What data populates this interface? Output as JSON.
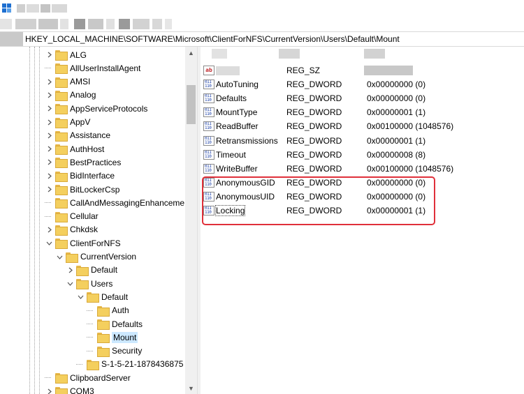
{
  "address": {
    "path": "HKEY_LOCAL_MACHINE\\SOFTWARE\\Microsoft\\ClientForNFS\\CurrentVersion\\Users\\Default\\Mount"
  },
  "tree": {
    "items": [
      {
        "label": "ALG",
        "expand": ">",
        "level": 0
      },
      {
        "label": "AllUserInstallAgent",
        "expand": "",
        "level": 0
      },
      {
        "label": "AMSI",
        "expand": ">",
        "level": 0
      },
      {
        "label": "Analog",
        "expand": ">",
        "level": 0
      },
      {
        "label": "AppServiceProtocols",
        "expand": ">",
        "level": 0
      },
      {
        "label": "AppV",
        "expand": ">",
        "level": 0
      },
      {
        "label": "Assistance",
        "expand": ">",
        "level": 0
      },
      {
        "label": "AuthHost",
        "expand": ">",
        "level": 0
      },
      {
        "label": "BestPractices",
        "expand": ">",
        "level": 0
      },
      {
        "label": "BidInterface",
        "expand": ">",
        "level": 0
      },
      {
        "label": "BitLockerCsp",
        "expand": ">",
        "level": 0
      },
      {
        "label": "CallAndMessagingEnhanceme",
        "expand": "",
        "level": 0
      },
      {
        "label": "Cellular",
        "expand": "",
        "level": 0
      },
      {
        "label": "Chkdsk",
        "expand": ">",
        "level": 0
      },
      {
        "label": "ClientForNFS",
        "expand": "v",
        "level": 0
      },
      {
        "label": "CurrentVersion",
        "expand": "v",
        "level": 1
      },
      {
        "label": "Default",
        "expand": ">",
        "level": 2
      },
      {
        "label": "Users",
        "expand": "v",
        "level": 2
      },
      {
        "label": "Default",
        "expand": "v",
        "level": 3
      },
      {
        "label": "Auth",
        "expand": "",
        "level": 4
      },
      {
        "label": "Defaults",
        "expand": "",
        "level": 4
      },
      {
        "label": "Mount",
        "expand": "",
        "level": 4,
        "selected": true
      },
      {
        "label": "Security",
        "expand": "",
        "level": 4
      },
      {
        "label": "S-1-5-21-1878436875",
        "expand": "",
        "level": 3
      },
      {
        "label": "ClipboardServer",
        "expand": "",
        "level": 0
      },
      {
        "label": "COM3",
        "expand": ">",
        "level": 0
      }
    ]
  },
  "values": {
    "rows": [
      {
        "icon": "ab",
        "name": "",
        "type": "REG_SZ",
        "data": ""
      },
      {
        "icon": "bin",
        "name": "AutoTuning",
        "type": "REG_DWORD",
        "data": "0x00000000 (0)"
      },
      {
        "icon": "bin",
        "name": "Defaults",
        "type": "REG_DWORD",
        "data": "0x00000000 (0)"
      },
      {
        "icon": "bin",
        "name": "MountType",
        "type": "REG_DWORD",
        "data": "0x00000001 (1)"
      },
      {
        "icon": "bin",
        "name": "ReadBuffer",
        "type": "REG_DWORD",
        "data": "0x00100000 (1048576)"
      },
      {
        "icon": "bin",
        "name": "Retransmissions",
        "type": "REG_DWORD",
        "data": "0x00000001 (1)"
      },
      {
        "icon": "bin",
        "name": "Timeout",
        "type": "REG_DWORD",
        "data": "0x00000008 (8)"
      },
      {
        "icon": "bin",
        "name": "WriteBuffer",
        "type": "REG_DWORD",
        "data": "0x00100000 (1048576)"
      },
      {
        "icon": "bin",
        "name": "AnonymousGID",
        "type": "REG_DWORD",
        "data": "0x00000000 (0)"
      },
      {
        "icon": "bin",
        "name": "AnonymousUID",
        "type": "REG_DWORD",
        "data": "0x00000000 (0)"
      },
      {
        "icon": "bin",
        "name": "Locking",
        "type": "REG_DWORD",
        "data": "0x00000001 (1)",
        "focused": true
      }
    ]
  },
  "icons": {
    "string_value": "ab-string-icon",
    "binary_value": "dword-value-icon",
    "folder": "folder-icon",
    "app": "registry-editor-icon"
  },
  "colors": {
    "highlight_border": "#e0303a",
    "selection": "#cce8ff",
    "folder": "#f4cf5e"
  }
}
